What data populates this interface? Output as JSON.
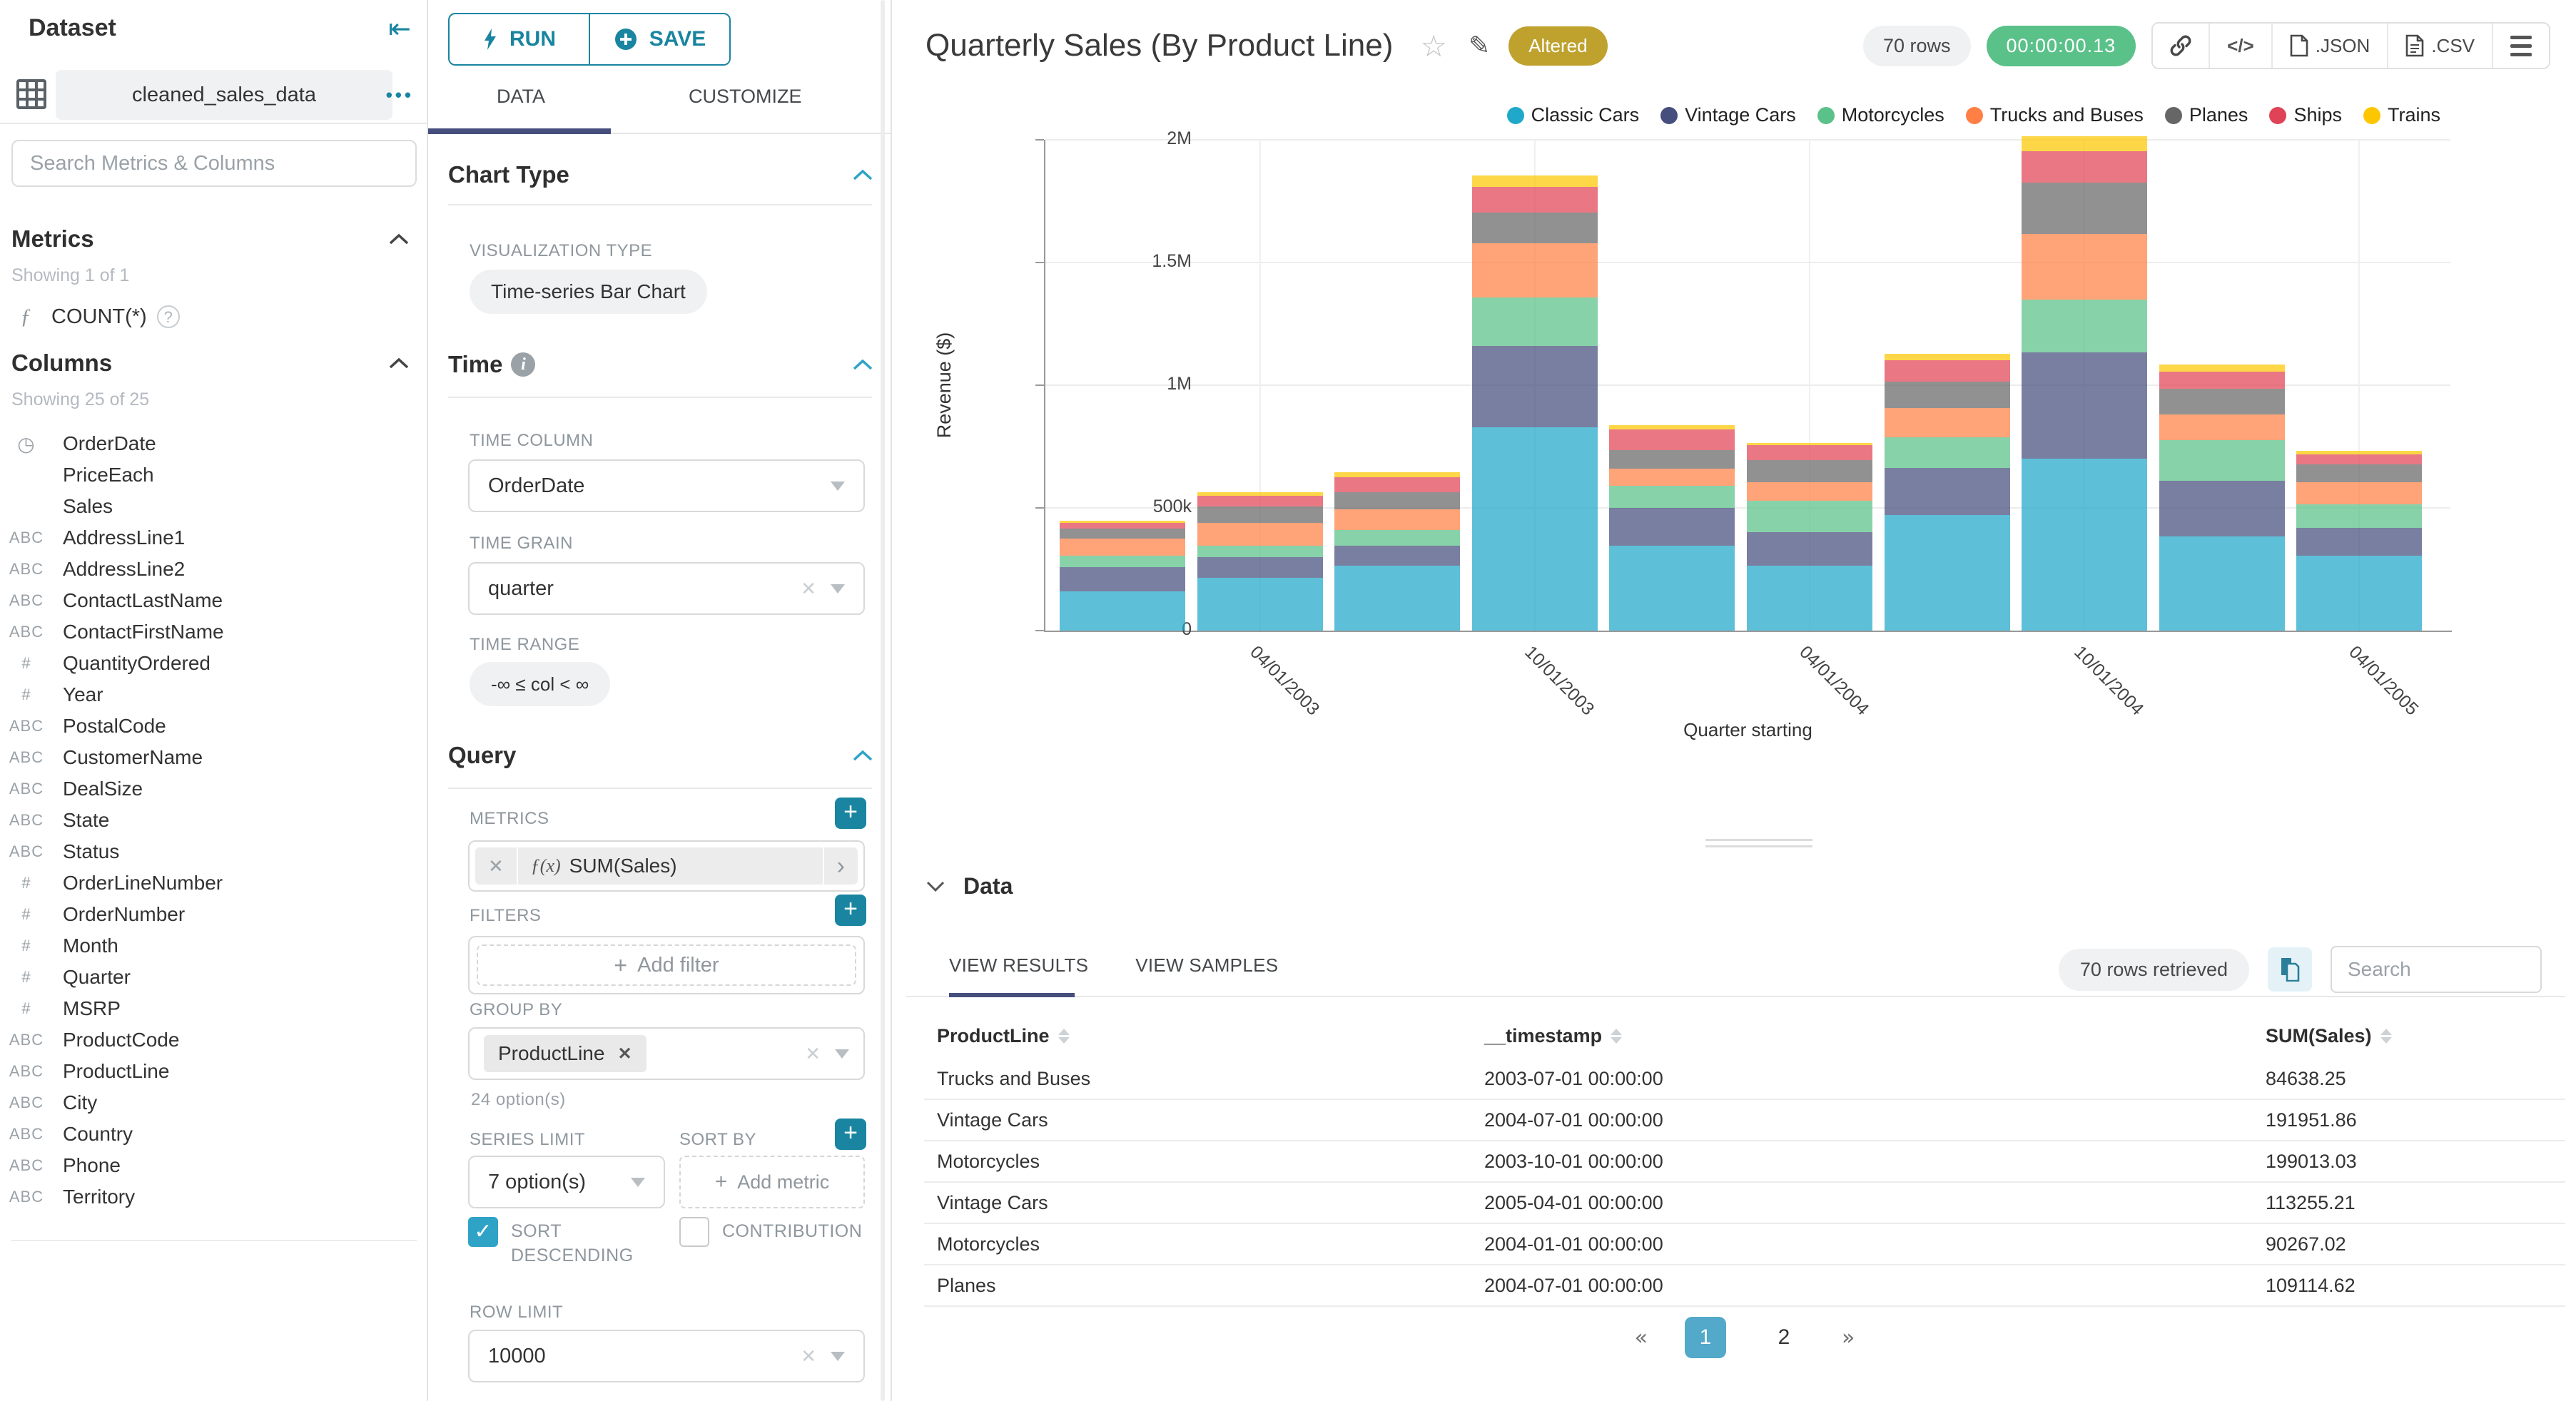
{
  "sidebar": {
    "title": "Dataset",
    "dataset_name": "cleaned_sales_data",
    "menu_dots": "•••",
    "search_placeholder": "Search Metrics & Columns",
    "metrics_header": "Metrics",
    "metrics_count": "Showing 1 of 1",
    "metric_fx": "ƒ",
    "metric_name": "COUNT(*)",
    "metric_help": "?",
    "columns_header": "Columns",
    "columns_count": "Showing 25 of 25",
    "columns": [
      {
        "name": "OrderDate",
        "icon": "clock"
      },
      {
        "name": "PriceEach",
        "icon": "none"
      },
      {
        "name": "Sales",
        "icon": "none"
      },
      {
        "name": "AddressLine1",
        "icon": "abc"
      },
      {
        "name": "AddressLine2",
        "icon": "abc"
      },
      {
        "name": "ContactLastName",
        "icon": "abc"
      },
      {
        "name": "ContactFirstName",
        "icon": "abc"
      },
      {
        "name": "QuantityOrdered",
        "icon": "num"
      },
      {
        "name": "Year",
        "icon": "num"
      },
      {
        "name": "PostalCode",
        "icon": "abc"
      },
      {
        "name": "CustomerName",
        "icon": "abc"
      },
      {
        "name": "DealSize",
        "icon": "abc"
      },
      {
        "name": "State",
        "icon": "abc"
      },
      {
        "name": "Status",
        "icon": "abc"
      },
      {
        "name": "OrderLineNumber",
        "icon": "num"
      },
      {
        "name": "OrderNumber",
        "icon": "num"
      },
      {
        "name": "Month",
        "icon": "num"
      },
      {
        "name": "Quarter",
        "icon": "num"
      },
      {
        "name": "MSRP",
        "icon": "num"
      },
      {
        "name": "ProductCode",
        "icon": "abc"
      },
      {
        "name": "ProductLine",
        "icon": "abc"
      },
      {
        "name": "City",
        "icon": "abc"
      },
      {
        "name": "Country",
        "icon": "abc"
      },
      {
        "name": "Phone",
        "icon": "abc"
      },
      {
        "name": "Territory",
        "icon": "abc"
      }
    ]
  },
  "controls": {
    "run_label": "RUN",
    "save_label": "SAVE",
    "tab_data": "DATA",
    "tab_customize": "CUSTOMIZE",
    "chart_type_header": "Chart Type",
    "viz_type_label": "VISUALIZATION TYPE",
    "viz_type_value": "Time-series Bar Chart",
    "time_header": "Time",
    "time_column_label": "TIME COLUMN",
    "time_column_value": "OrderDate",
    "time_grain_label": "TIME GRAIN",
    "time_grain_value": "quarter",
    "time_range_label": "TIME RANGE",
    "time_range_value": "-∞ ≤ col < ∞",
    "query_header": "Query",
    "metrics_label": "METRICS",
    "metric_fx": "ƒ(x)",
    "metric_value": "SUM(Sales)",
    "filters_label": "FILTERS",
    "add_filter_label": "Add filter",
    "group_by_label": "GROUP BY",
    "group_by_value": "ProductLine",
    "group_by_options": "24 option(s)",
    "series_limit_label": "SERIES LIMIT",
    "series_limit_value": "7 option(s)",
    "sort_by_label": "SORT BY",
    "add_metric_label": "Add metric",
    "sort_descending_label": "SORT DESCENDING",
    "contribution_label": "CONTRIBUTION",
    "row_limit_label": "ROW LIMIT",
    "row_limit_value": "10000"
  },
  "chart_header": {
    "title": "Quarterly Sales (By Product Line)",
    "altered_badge": "Altered",
    "rows_badge": "70 rows",
    "timer_badge": "00:00:00.13",
    "export_json_label": ".JSON",
    "export_csv_label": ".CSV",
    "code_glyph": "</>"
  },
  "chart_data": {
    "type": "bar",
    "stacked": true,
    "title": "Quarterly Sales (By Product Line)",
    "xlabel": "Quarter starting",
    "ylabel": "Revenue ($)",
    "ylim": [
      0,
      2000000
    ],
    "ytick_labels": [
      "0",
      "500k",
      "1M",
      "1.5M",
      "2M"
    ],
    "grid": true,
    "legend_position": "top-right",
    "x": [
      "01/01/2003",
      "04/01/2003",
      "07/01/2003",
      "10/01/2003",
      "01/01/2004",
      "04/01/2004",
      "07/01/2004",
      "10/01/2004",
      "01/01/2005",
      "04/01/2005"
    ],
    "x_tick_indices": [
      1,
      3,
      5,
      7,
      9
    ],
    "series": [
      {
        "name": "Classic Cars",
        "color": "#1FA8C9",
        "values": [
          160000,
          215000,
          265000,
          830000,
          345000,
          265000,
          470000,
          700000,
          385000,
          305000
        ]
      },
      {
        "name": "Vintage Cars",
        "color": "#454E7C",
        "values": [
          100000,
          85000,
          80000,
          330000,
          155000,
          135000,
          191952,
          435000,
          225000,
          113255
        ]
      },
      {
        "name": "Motorcycles",
        "color": "#5AC189",
        "values": [
          45000,
          45000,
          65000,
          199013,
          90267,
          130000,
          125000,
          215000,
          165000,
          95000
        ]
      },
      {
        "name": "Trucks and Buses",
        "color": "#FF7F44",
        "values": [
          70000,
          95000,
          84638,
          220000,
          70000,
          75000,
          120000,
          265000,
          105000,
          90000
        ]
      },
      {
        "name": "Planes",
        "color": "#666666",
        "values": [
          40000,
          65000,
          70000,
          125000,
          75000,
          90000,
          109115,
          210000,
          105000,
          75000
        ]
      },
      {
        "name": "Ships",
        "color": "#E04355",
        "values": [
          25000,
          45000,
          60000,
          105000,
          85000,
          60000,
          85000,
          130000,
          70000,
          40000
        ]
      },
      {
        "name": "Trains",
        "color": "#FCC700",
        "values": [
          8000,
          15000,
          20000,
          46000,
          17000,
          10000,
          27000,
          60000,
          30000,
          15000
        ]
      }
    ]
  },
  "data_panel": {
    "header": "Data",
    "tab_results": "VIEW RESULTS",
    "tab_samples": "VIEW SAMPLES",
    "rows_retrieved": "70 rows retrieved",
    "search_placeholder": "Search",
    "table": {
      "headers": [
        "ProductLine",
        "__timestamp",
        "SUM(Sales)"
      ],
      "rows": [
        [
          "Trucks and Buses",
          "2003-07-01 00:00:00",
          "84638.25"
        ],
        [
          "Vintage Cars",
          "2004-07-01 00:00:00",
          "191951.86"
        ],
        [
          "Motorcycles",
          "2003-10-01 00:00:00",
          "199013.03"
        ],
        [
          "Vintage Cars",
          "2005-04-01 00:00:00",
          "113255.21"
        ],
        [
          "Motorcycles",
          "2004-01-01 00:00:00",
          "90267.02"
        ],
        [
          "Planes",
          "2004-07-01 00:00:00",
          "109114.62"
        ]
      ]
    },
    "pagination": {
      "prev": "«",
      "pages": [
        "1",
        "2"
      ],
      "active_page": "1",
      "next": "»"
    }
  },
  "colors": {
    "accent_teal": "#1985a0",
    "tab_indicator": "#454e7c",
    "altered_badge_bg": "#bfa12e",
    "timer_badge_bg": "#5ac189",
    "pagination_active_bg": "#52a9c9",
    "checkbox_on": "#2ea3c6",
    "bar_opacity": 0.72
  }
}
